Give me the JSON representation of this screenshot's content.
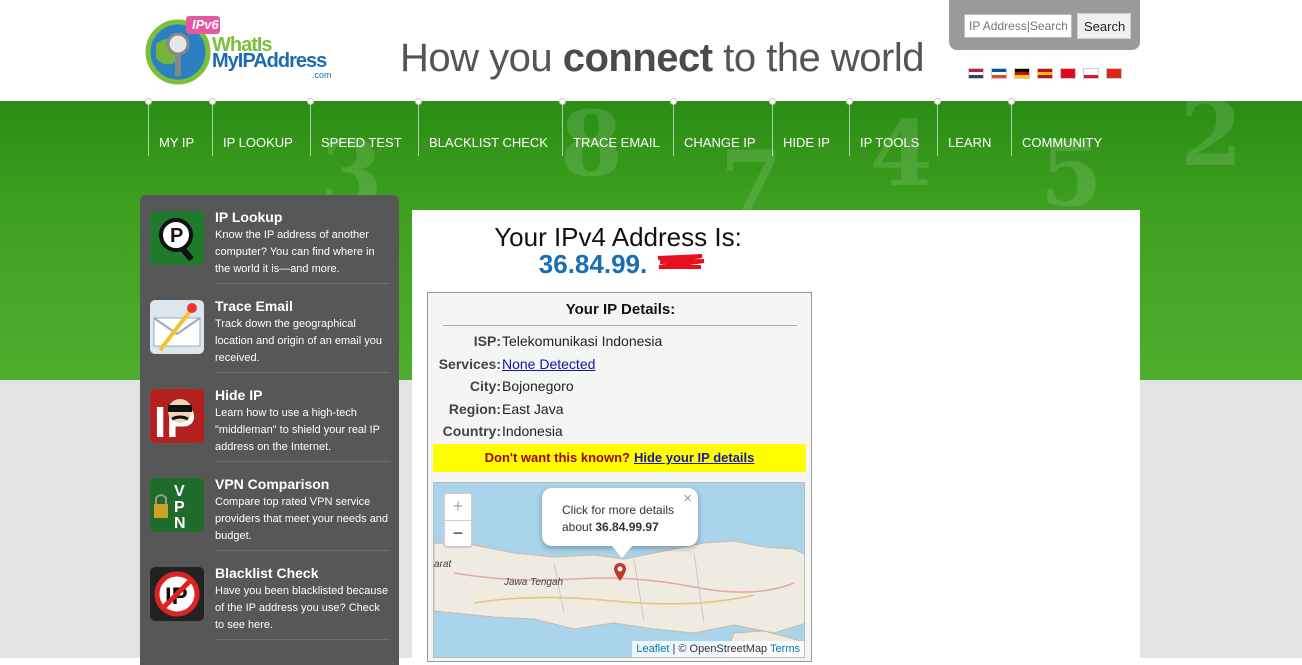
{
  "header": {
    "logo_ipv6": "IPv6",
    "logo_line1": "WhatIs",
    "logo_line2": "MyIPAddress",
    "logo_com": ".com",
    "tagline_pre": "How you ",
    "tagline_bold": "connect",
    "tagline_post": " to the world",
    "search_placeholder": "IP Address|Search",
    "search_button": "Search"
  },
  "flags": [
    {
      "name": "us-flag-icon",
      "colors": [
        "#b22234",
        "#ffffff",
        "#3c3b6e"
      ]
    },
    {
      "name": "fr-flag-icon",
      "colors": [
        "#0055a4",
        "#ffffff",
        "#ef4135"
      ]
    },
    {
      "name": "de-flag-icon",
      "colors": [
        "#000000",
        "#dd0000",
        "#ffce00"
      ]
    },
    {
      "name": "es-flag-icon",
      "colors": [
        "#c60b1e",
        "#ffc400",
        "#c60b1e"
      ]
    },
    {
      "name": "tr-flag-icon",
      "colors": [
        "#e30a17",
        "#e30a17",
        "#e30a17"
      ]
    },
    {
      "name": "pl-flag-icon",
      "colors": [
        "#ffffff",
        "#ffffff",
        "#dc143c"
      ]
    },
    {
      "name": "cn-flag-icon",
      "colors": [
        "#de2910",
        "#de2910",
        "#de2910"
      ]
    }
  ],
  "nav": {
    "items": [
      "MY IP",
      "IP LOOKUP",
      "SPEED TEST",
      "BLACKLIST CHECK",
      "TRACE EMAIL",
      "CHANGE IP",
      "HIDE IP",
      "IP TOOLS",
      "LEARN",
      "COMMUNITY"
    ]
  },
  "sidebar": {
    "items": [
      {
        "title": "IP Lookup",
        "desc": "Know the IP address of another computer? You can find where in the world it is—and more.",
        "icon": "ip-lookup-icon"
      },
      {
        "title": "Trace Email",
        "desc": "Track down the geographical location and origin of an email you received.",
        "icon": "trace-email-icon"
      },
      {
        "title": "Hide IP",
        "desc": "Learn how to use a high-tech \"middleman\" to shield your real IP address on the Internet.",
        "icon": "hide-ip-icon"
      },
      {
        "title": "VPN Comparison",
        "desc": "Compare top rated VPN service providers that meet your needs and budget.",
        "icon": "vpn-icon"
      },
      {
        "title": "Blacklist Check",
        "desc": "Have you been blacklisted because of the IP address you use? Check to see here.",
        "icon": "blacklist-icon"
      }
    ]
  },
  "main": {
    "heading": "Your IPv4 Address Is:",
    "ip": "36.84.99.",
    "details_title": "Your IP Details:",
    "rows": [
      {
        "label": "ISP:",
        "value": "Telekomunikasi Indonesia"
      },
      {
        "label": "Services:",
        "value": "None Detected"
      },
      {
        "label": "City:",
        "value": "Bojonegoro"
      },
      {
        "label": "Region:",
        "value": "East Java"
      },
      {
        "label": "Country:",
        "value": "Indonesia"
      }
    ],
    "warn_text": "Don't want this known?",
    "warn_link": "Hide your IP details"
  },
  "map": {
    "zoom_in": "+",
    "zoom_out": "−",
    "popup_line1": "Click for more details",
    "popup_line2_pre": "about ",
    "popup_ip": "36.84.99.97",
    "popup_close": "×",
    "label_jawa": "Jawa Tengah",
    "label_barat": "arat",
    "attr_leaflet": "Leaflet",
    "attr_osm": " | © OpenStreetMap ",
    "attr_terms": "Terms"
  }
}
